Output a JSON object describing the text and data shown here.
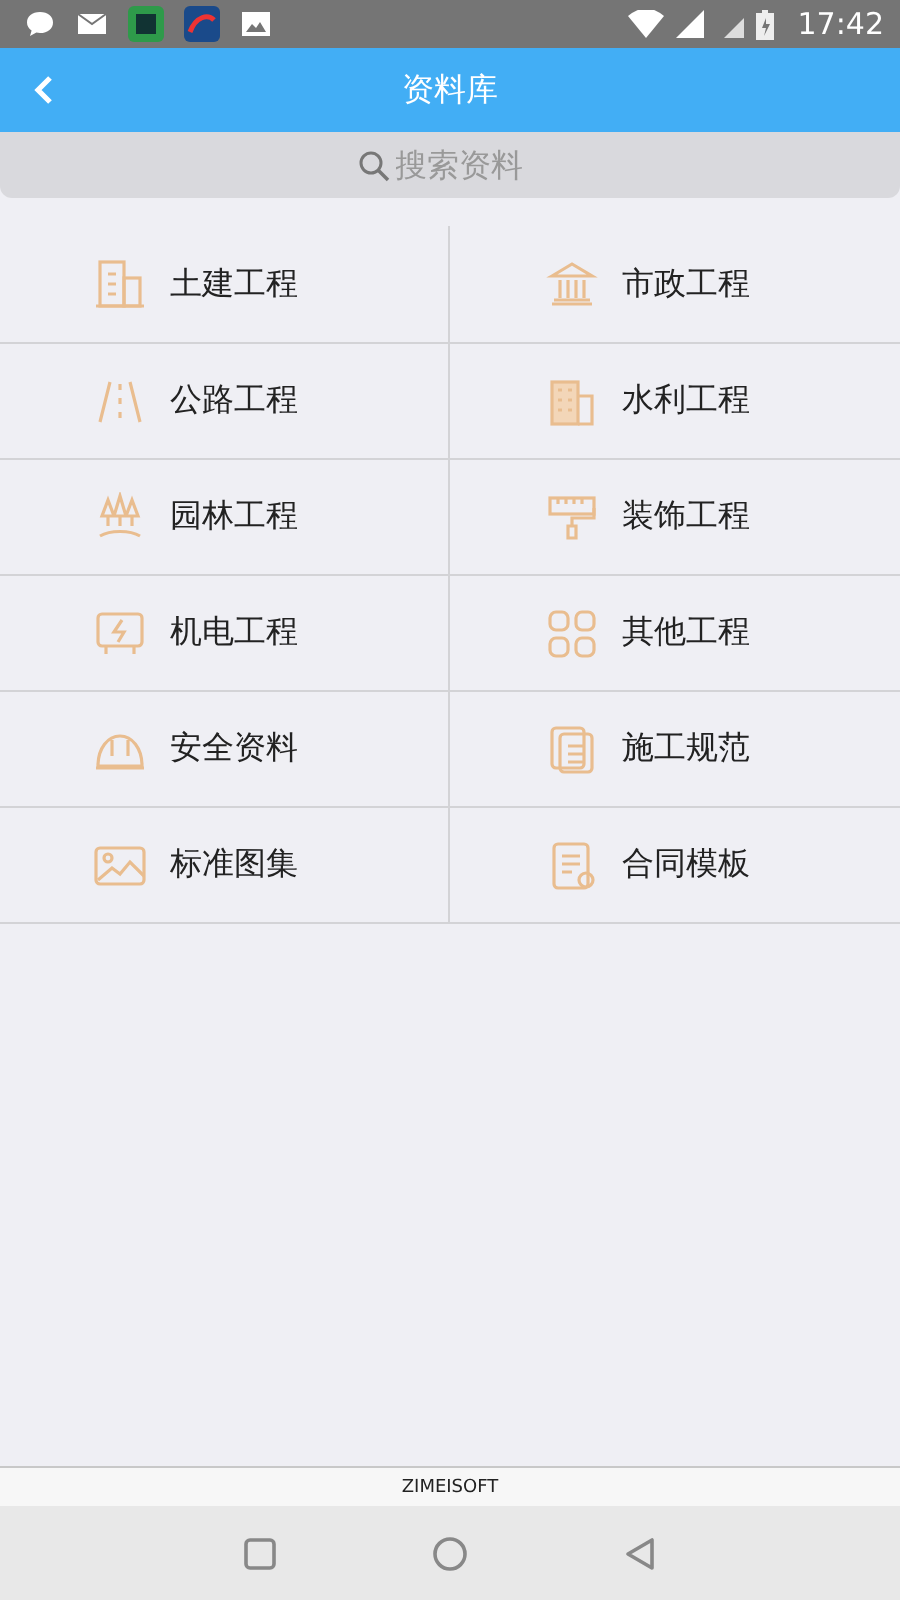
{
  "status_bar": {
    "time": "17:42"
  },
  "header": {
    "title": "资料库"
  },
  "search": {
    "placeholder": "搜索资料"
  },
  "categories": [
    {
      "label": "土建工程"
    },
    {
      "label": "市政工程"
    },
    {
      "label": "公路工程"
    },
    {
      "label": "水利工程"
    },
    {
      "label": "园林工程"
    },
    {
      "label": "装饰工程"
    },
    {
      "label": "机电工程"
    },
    {
      "label": "其他工程"
    },
    {
      "label": "安全资料"
    },
    {
      "label": "施工规范"
    },
    {
      "label": "标准图集"
    },
    {
      "label": "合同模板"
    }
  ],
  "footer": {
    "text": "ZIMEISOFT"
  }
}
